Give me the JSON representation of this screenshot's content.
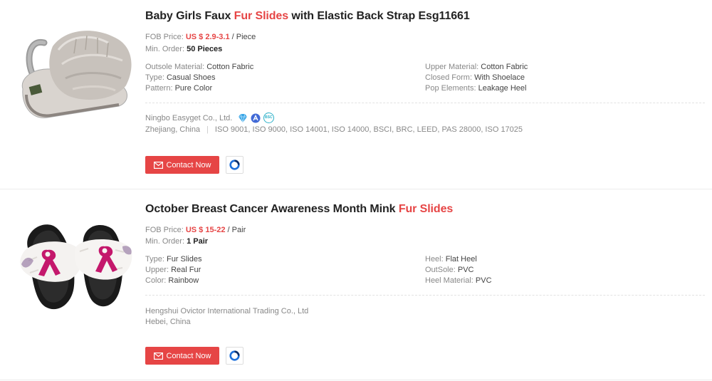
{
  "products": [
    {
      "title_pre": "Baby Girls Faux ",
      "title_hl": "Fur Slides",
      "title_post": " with Elastic Back Strap Esg11661",
      "fob_label": "FOB Price: ",
      "fob_value": "US $ 2.9-3.1",
      "fob_unit": " / Piece",
      "min_label": "Min. Order: ",
      "min_value": "50 Pieces",
      "props_left": [
        {
          "label": "Outsole Material: ",
          "value": "Cotton Fabric"
        },
        {
          "label": "Type: ",
          "value": "Casual Shoes"
        },
        {
          "label": "Pattern: ",
          "value": "Pure Color"
        }
      ],
      "props_right": [
        {
          "label": "Upper Material: ",
          "value": "Cotton Fabric"
        },
        {
          "label": "Closed Form: ",
          "value": "With Shoelace"
        },
        {
          "label": "Pop Elements: ",
          "value": "Leakage Heel"
        }
      ],
      "company": "Ningbo Easyget Co., Ltd.",
      "badges": [
        "diamond-member-icon",
        "audited-supplier-icon",
        "bsc-certified-icon"
      ],
      "badge_bsc_text": "BSC",
      "location": "Zhejiang, China",
      "certifications": "ISO 9001, ISO 9000, ISO 14001, ISO 14000, BSCI, BRC, LEED, PAS 28000, ISO 17025",
      "contact_label": "Contact Now"
    },
    {
      "title_pre": "October Breast Cancer Awareness Month Mink ",
      "title_hl": "Fur Slides",
      "title_post": "",
      "fob_label": "FOB Price: ",
      "fob_value": "US $ 15-22",
      "fob_unit": " / Pair",
      "min_label": "Min. Order: ",
      "min_value": "1 Pair",
      "props_left": [
        {
          "label": "Type: ",
          "value": "Fur Slides"
        },
        {
          "label": "Upper: ",
          "value": "Real Fur"
        },
        {
          "label": "Color: ",
          "value": "Rainbow"
        }
      ],
      "props_right": [
        {
          "label": "Heel: ",
          "value": "Flat Heel"
        },
        {
          "label": "OutSole: ",
          "value": "PVC"
        },
        {
          "label": "Heel Material: ",
          "value": "PVC"
        }
      ],
      "company": "Hengshui Ovictor International Trading Co., Ltd",
      "location": "Hebei, China",
      "contact_label": "Contact Now"
    }
  ],
  "colors": {
    "accent": "#e64545",
    "muted": "#888888",
    "chat_blue": "#1e6fd9"
  }
}
